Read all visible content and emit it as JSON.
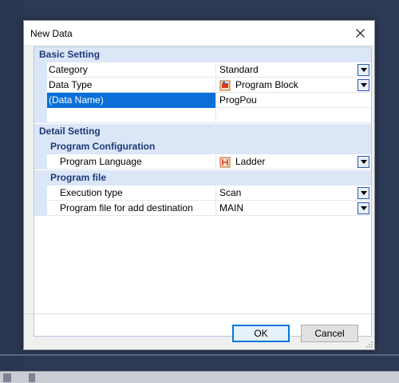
{
  "dialog": {
    "title": "New Data",
    "ok_label": "OK",
    "cancel_label": "Cancel"
  },
  "sections": {
    "basic": "Basic Setting",
    "detail": "Detail Setting",
    "program_config": "Program Configuration",
    "program_file": "Program file"
  },
  "props": {
    "category": {
      "label": "Category",
      "value": "Standard"
    },
    "data_type": {
      "label": "Data Type",
      "value": "Program Block",
      "icon": "program-block-icon"
    },
    "data_name": {
      "label": "(Data Name)",
      "value": "ProgPou"
    },
    "program_language": {
      "label": "Program Language",
      "value": "Ladder",
      "icon": "ladder-icon"
    },
    "execution_type": {
      "label": "Execution type",
      "value": "Scan"
    },
    "add_destination": {
      "label": "Program file for add destination",
      "value": "MAIN"
    }
  },
  "colors": {
    "section_bg": "#dbe6f7",
    "section_text": "#1e3a78",
    "selection": "#0a6fd6"
  }
}
